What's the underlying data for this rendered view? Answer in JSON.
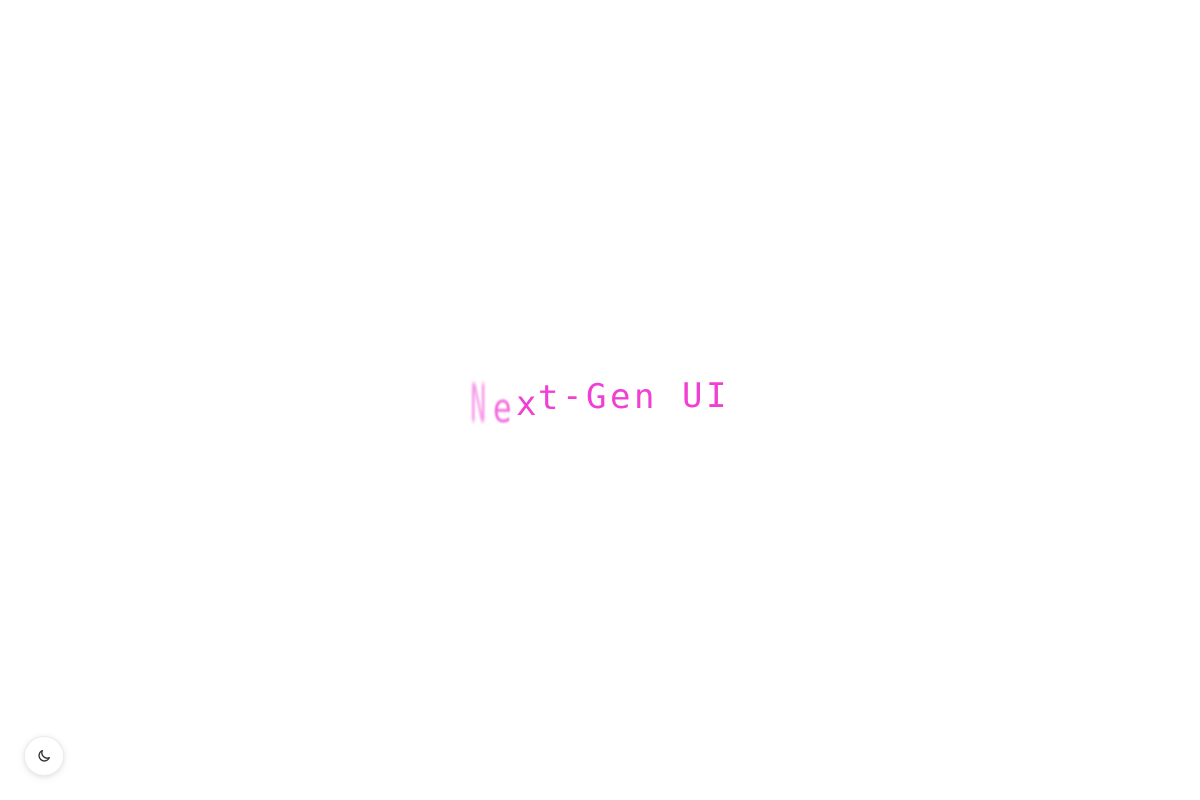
{
  "hero": {
    "title": "Next-Gen UI",
    "accent_color": "#f03fd2"
  },
  "theme_toggle": {
    "icon": "moon-icon"
  }
}
